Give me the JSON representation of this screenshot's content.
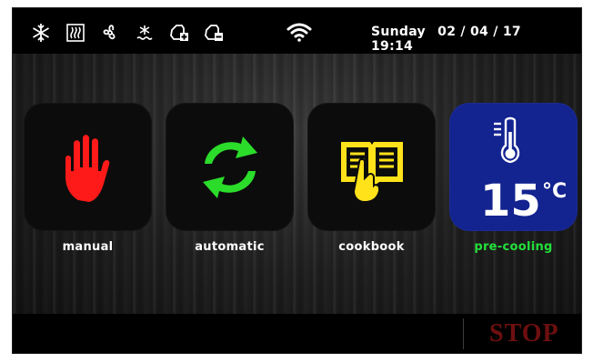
{
  "status_bar": {
    "icons": [
      "snowflake-icon",
      "heating-icon",
      "fan-icon",
      "defrost-icon",
      "plus-hex-icon",
      "minus-hex-icon"
    ],
    "wifi_icon": "wifi-icon",
    "day": "Sunday",
    "date": "02 / 04 / 17",
    "time": "19:14"
  },
  "tiles": [
    {
      "label": "manual",
      "icon": "hand-icon",
      "color": "#ff1a1a"
    },
    {
      "label": "automatic",
      "icon": "cycle-arrows-icon",
      "color": "#2bdc2b"
    },
    {
      "label": "cookbook",
      "icon": "book-icon",
      "color": "#ffe21a"
    },
    {
      "label": "pre-cooling",
      "icon": "thermometer-icon",
      "color": "#13238f",
      "label_color": "#23e03a",
      "temperature": "15",
      "unit": "°C"
    }
  ],
  "bottom_bar": {
    "stop_label": "STOP",
    "stop_color": "#6e0f0f"
  }
}
